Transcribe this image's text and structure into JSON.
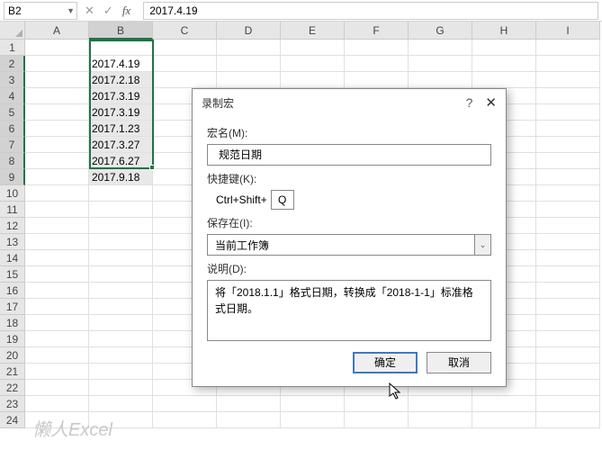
{
  "cellRef": "B2",
  "formulaValue": "2017.4.19",
  "columns": [
    "A",
    "B",
    "C",
    "D",
    "E",
    "F",
    "G",
    "H",
    "I"
  ],
  "rowCount": 24,
  "dataColumnIndex": 1,
  "cellData": [
    "2017.4.19",
    "2017.2.18",
    "2017.3.19",
    "2017.3.19",
    "2017.1.23",
    "2017.3.27",
    "2017.6.27",
    "2017.9.18"
  ],
  "dialog": {
    "title": "录制宏",
    "labels": {
      "macroName": "宏名(M):",
      "shortcut": "快捷键(K):",
      "shortcutPrefix": "Ctrl+Shift+",
      "saveIn": "保存在(I):",
      "description": "说明(D):"
    },
    "values": {
      "macroName": "规范日期",
      "shortcutKey": "Q",
      "saveIn": "当前工作簿",
      "description": "将「2018.1.1」格式日期，转换成「2018-1-1」标准格式日期。"
    },
    "buttons": {
      "ok": "确定",
      "cancel": "取消"
    },
    "help": "?",
    "close": "✕"
  },
  "watermark": "懒人Excel"
}
